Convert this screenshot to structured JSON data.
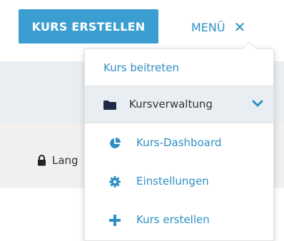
{
  "header": {
    "create_button": "KURS ERSTELLEN",
    "menu_label": "MENÜ",
    "close_glyph": "✕"
  },
  "background": {
    "language_label": "Lang"
  },
  "dropdown": {
    "join_label": "Kurs beitreten",
    "manage_label": "Kursverwaltung",
    "items": [
      {
        "label": "Kurs-Dashboard",
        "icon": "pie-chart-icon"
      },
      {
        "label": "Einstellungen",
        "icon": "gear-icon"
      },
      {
        "label": "Kurs erstellen",
        "icon": "plus-icon"
      }
    ]
  },
  "colors": {
    "accent": "#3a9fd0",
    "link": "#2e8fc4",
    "highlight_bg": "#e8eef2"
  }
}
